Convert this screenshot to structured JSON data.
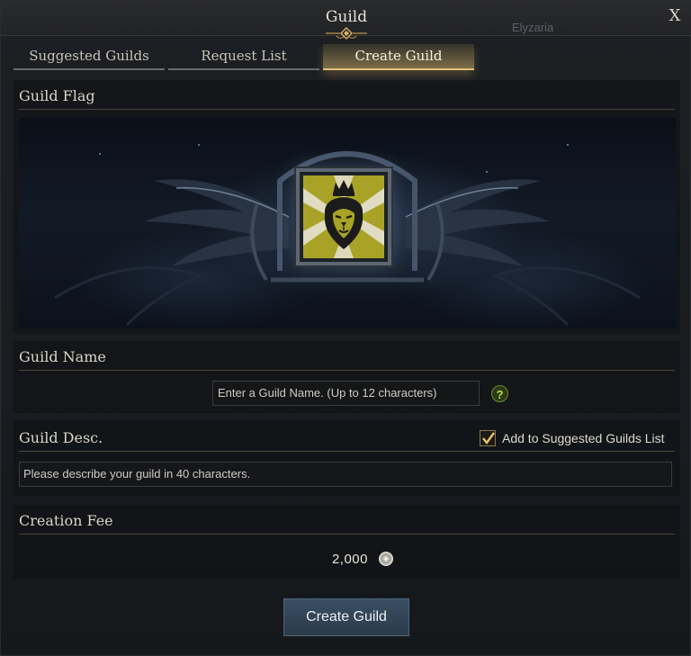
{
  "window": {
    "title": "Guild",
    "background_name": "Elyzaria",
    "close_label": "X"
  },
  "tabs": [
    {
      "label": "Suggested Guilds",
      "active": false
    },
    {
      "label": "Request List",
      "active": false
    },
    {
      "label": "Create Guild",
      "active": true
    }
  ],
  "guild_flag": {
    "section_title": "Guild Flag",
    "emblem": "crowned-lion-icon",
    "flag_color": "#a8a326"
  },
  "guild_name": {
    "section_title": "Guild Name",
    "value": "",
    "placeholder": "Enter a Guild Name. (Up to 12 characters)",
    "help_label": "?"
  },
  "guild_desc": {
    "section_title": "Guild Desc.",
    "checkbox_label": "Add to Suggested Guilds List",
    "checkbox_checked": true,
    "value": "",
    "placeholder": "Please describe your guild in 40 characters."
  },
  "creation_fee": {
    "section_title": "Creation Fee",
    "amount": "2,000",
    "currency_icon": "silver-coin-icon"
  },
  "create_button": {
    "label": "Create Guild"
  },
  "colors": {
    "accent_gold": "#e0c27a",
    "button_blue": "#33475a",
    "help_green": "#b8e04a"
  }
}
